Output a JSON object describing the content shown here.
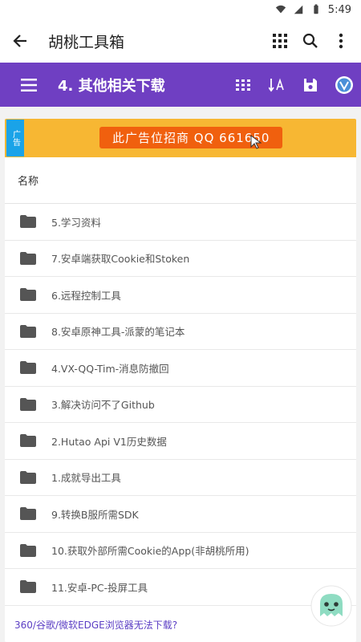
{
  "status": {
    "time": "5:49"
  },
  "appbar": {
    "title": "胡桃工具箱"
  },
  "toolbar": {
    "title": "4. 其他相关下载"
  },
  "ad": {
    "badge": "广告",
    "text": "此广告位招商 QQ 661650"
  },
  "list": {
    "header": "名称",
    "items": [
      {
        "name": "5.学习资料"
      },
      {
        "name": "7.安卓端获取Cookie和Stoken"
      },
      {
        "name": "6.远程控制工具"
      },
      {
        "name": "8.安卓原神工具-派蒙的笔记本"
      },
      {
        "name": "4.VX-QQ-Tim-消息防撤回"
      },
      {
        "name": "3.解决访问不了Github"
      },
      {
        "name": "2.Hutao Api V1历史数据"
      },
      {
        "name": "1.成就导出工具"
      },
      {
        "name": "9.转换B服所需SDK"
      },
      {
        "name": "10.获取外部所需Cookie的App(非胡桃所用)"
      },
      {
        "name": "11.安卓-PC-投屏工具"
      }
    ]
  },
  "footer": {
    "link": "360/谷歌/微软EDGE浏览器无法下载?"
  },
  "colors": {
    "accent": "#6f3fc2",
    "ad_bg": "#f7b733",
    "ad_text_bg": "#f0600e",
    "folder": "#555555"
  }
}
